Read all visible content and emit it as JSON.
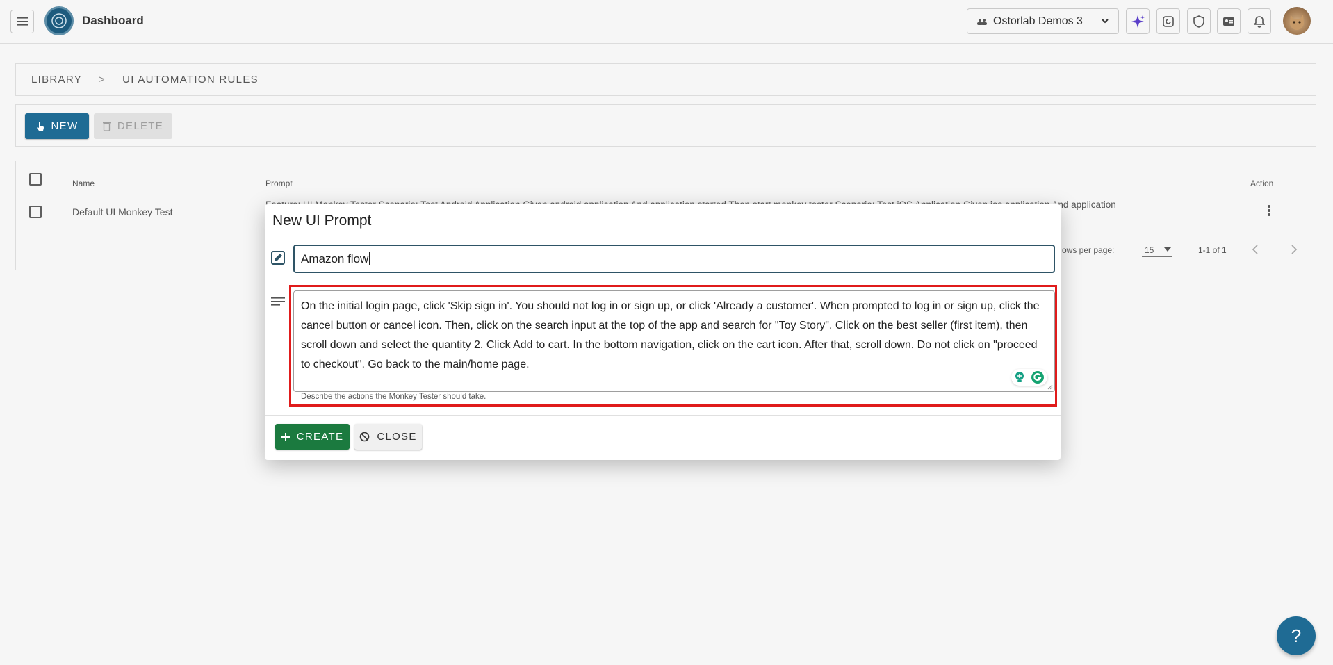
{
  "header": {
    "title": "Dashboard",
    "org_name": "Ostorlab Demos 3"
  },
  "breadcrumb": {
    "items": [
      "LIBRARY",
      "UI AUTOMATION RULES"
    ],
    "separator": ">"
  },
  "toolbar": {
    "new_label": "NEW",
    "delete_label": "DELETE"
  },
  "table": {
    "columns": [
      "Name",
      "Prompt",
      "Action"
    ],
    "rows": [
      {
        "name": "Default UI Monkey Test",
        "prompt": "Feature: UI Monkey Tester Scenario: Test Android Application Given android application And application started Then start monkey tester Scenario: Test iOS Application Given ios application And application"
      }
    ],
    "footer": {
      "rows_per_page_label": "ows per page:",
      "rows_per_page_value": "15",
      "range": "1-1 of 1"
    }
  },
  "modal": {
    "title": "New UI Prompt",
    "name_value": "Amazon flow",
    "prompt_value": "On the initial login page, click 'Skip sign in'. You should not log in or sign up, or click 'Already a customer'. When prompted to log in or sign up, click the cancel button or cancel icon. Then, click on the search input at the top of the app and search for \"Toy Story\". Click on the best seller (first item), then scroll down and select the quantity 2. Click Add to cart. In the bottom navigation, click on the cart icon. After that, scroll down. Do not click on \"proceed to checkout\". Go back to the main/home page.",
    "prompt_helper": "Describe the actions the Monkey Tester should take.",
    "create_label": "CREATE",
    "close_label": "CLOSE"
  },
  "help": {
    "label": "?"
  },
  "colors": {
    "primary": "#1f6b94",
    "success": "#1b7a3f",
    "highlight": "#e01b1b",
    "background": "#f6f6f6"
  }
}
